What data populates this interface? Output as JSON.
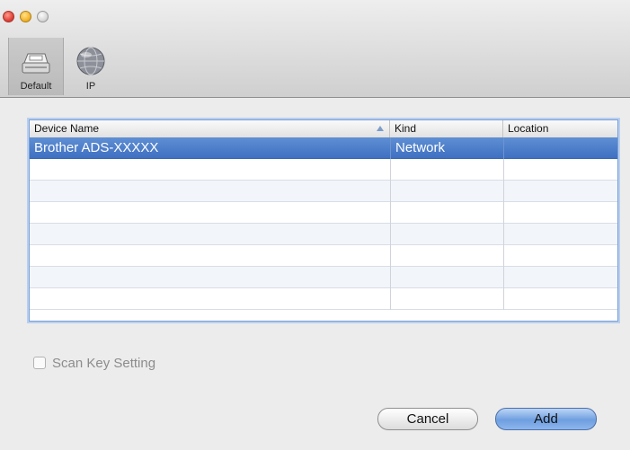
{
  "toolbar": {
    "items": [
      {
        "label": "Default",
        "icon": "scanner-icon",
        "selected": true
      },
      {
        "label": "IP",
        "icon": "globe-icon",
        "selected": false
      }
    ]
  },
  "table": {
    "columns": [
      "Device Name",
      "Kind",
      "Location"
    ],
    "sort_column": "Device Name",
    "sort_direction": "ascending",
    "rows": [
      {
        "device_name": "Brother ADS-XXXXX",
        "kind": "Network",
        "location": "",
        "selected": true
      }
    ]
  },
  "scan_key_setting": {
    "label": "Scan Key Setting",
    "checked": false,
    "enabled": false
  },
  "buttons": {
    "cancel": "Cancel",
    "add": "Add"
  },
  "colors": {
    "selection": "#4a7bcb",
    "default_button": "#7aa7e6"
  }
}
